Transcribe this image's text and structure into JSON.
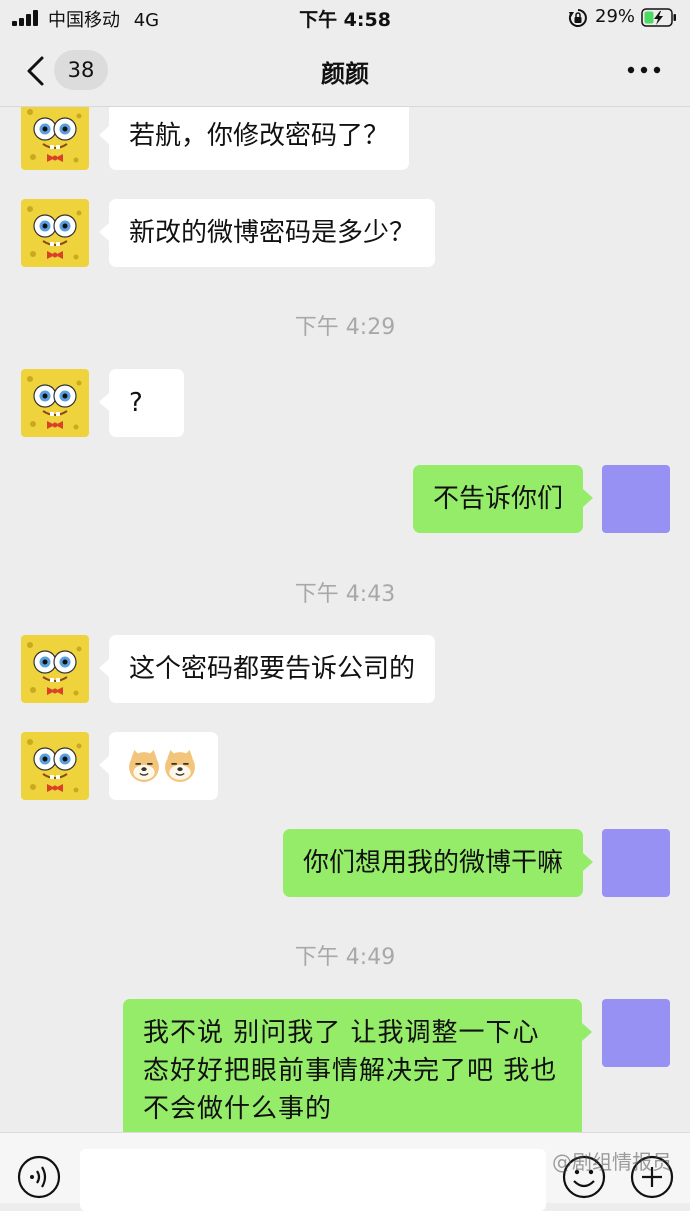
{
  "status_bar": {
    "carrier": "中国移动",
    "network": "4G",
    "time": "下午 4:58",
    "battery_percent": "29%",
    "icons": [
      "signal-icon",
      "orientation-lock-icon",
      "battery-charging-icon"
    ]
  },
  "nav": {
    "unread_count": "38",
    "title": "颜颜",
    "icons": [
      "back-icon",
      "more-icon"
    ]
  },
  "messages": [
    {
      "side": "in",
      "text": "若航，你修改密码了？"
    },
    {
      "side": "in",
      "text": "新改的微博密码是多少？"
    },
    {
      "type": "time",
      "text": "下午 4:29"
    },
    {
      "side": "in",
      "text": "?"
    },
    {
      "side": "out",
      "text": "不告诉你们"
    },
    {
      "type": "time",
      "text": "下午 4:43"
    },
    {
      "side": "in",
      "text": "这个密码都要告诉公司的"
    },
    {
      "side": "in",
      "type": "emoji",
      "text": "doge-emoji doge-emoji"
    },
    {
      "side": "out",
      "text": "你们想用我的微博干嘛"
    },
    {
      "type": "time",
      "text": "下午 4:49"
    },
    {
      "side": "out",
      "text": "我不说 别问我了 让我调整一下心态好好把眼前事情解决完了吧  我也不会做什么事的"
    }
  ],
  "input_bar": {
    "icons": [
      "voice-icon",
      "emoji-icon",
      "plus-icon"
    ]
  },
  "watermark": "@剧组情报员",
  "colors": {
    "background": "#ededed",
    "incoming_bubble": "#ffffff",
    "outgoing_bubble": "#95ec69",
    "self_avatar": "#9791f3",
    "timestamp_text": "#a8a8a8"
  }
}
